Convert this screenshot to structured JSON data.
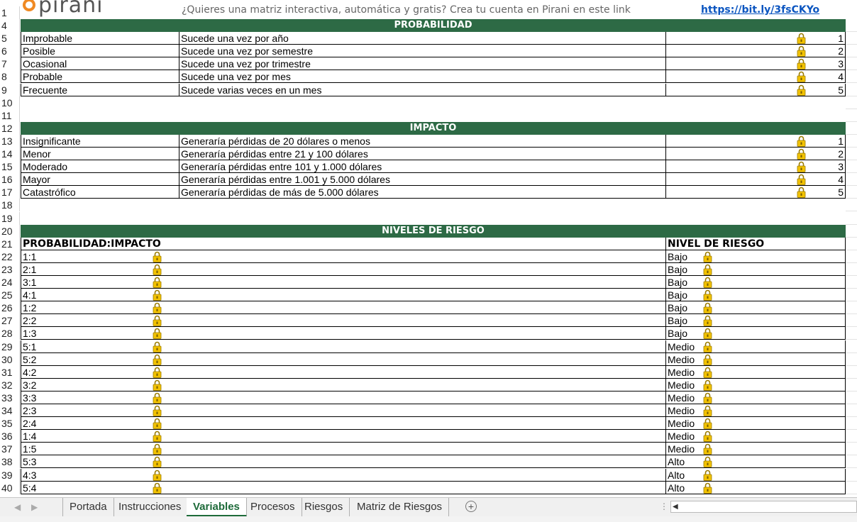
{
  "app": {
    "logo_text": "pirani"
  },
  "promo": {
    "text": "¿Quieres una matriz interactiva, automática y gratis? Crea tu cuenta en Pirani en este link",
    "link": "https://bit.ly/3fsCKYo"
  },
  "row_numbers": [
    "1",
    "4",
    "5",
    "6",
    "7",
    "8",
    "9",
    "10",
    "11",
    "12",
    "13",
    "14",
    "15",
    "16",
    "17",
    "18",
    "19",
    "20",
    "21",
    "22",
    "23",
    "24",
    "25",
    "26",
    "27",
    "28",
    "29",
    "30",
    "31",
    "32",
    "33",
    "34",
    "35",
    "36",
    "37",
    "38",
    "39",
    "40"
  ],
  "probabilidad": {
    "title": "PROBABILIDAD",
    "rows": [
      {
        "name": "Improbable",
        "desc": "Sucede una vez por año",
        "value": "1"
      },
      {
        "name": "Posible",
        "desc": "Sucede una vez por semestre",
        "value": "2"
      },
      {
        "name": "Ocasional",
        "desc": "Sucede una vez por trimestre",
        "value": "3"
      },
      {
        "name": "Probable",
        "desc": "Sucede una vez por mes",
        "value": "4"
      },
      {
        "name": "Frecuente",
        "desc": "Sucede varias veces en un mes",
        "value": "5"
      }
    ]
  },
  "impacto": {
    "title": "IMPACTO",
    "rows": [
      {
        "name": "Insignificante",
        "desc": "Generaría pérdidas de 20 dólares o menos",
        "value": "1"
      },
      {
        "name": "Menor",
        "desc": "Generaría pérdidas entre 21 y 100 dólares",
        "value": "2"
      },
      {
        "name": "Moderado",
        "desc": "Generaría pérdidas entre 101 y 1.000 dólares",
        "value": "3"
      },
      {
        "name": "Mayor",
        "desc": "Generaría pérdidas entre 1.001 y 5.000 dólares",
        "value": "4"
      },
      {
        "name": "Catastrófico",
        "desc": "Generaría pérdidas de más de 5.000 dólares",
        "value": "5"
      }
    ]
  },
  "niveles": {
    "title": "NIVELES DE RIESGO",
    "col1": "PROBABILIDAD:IMPACTO",
    "col2": "NIVEL DE RIESGO",
    "rows": [
      {
        "pi": "1:1",
        "level": "Bajo"
      },
      {
        "pi": "2:1",
        "level": "Bajo"
      },
      {
        "pi": "3:1",
        "level": "Bajo"
      },
      {
        "pi": "4:1",
        "level": "Bajo"
      },
      {
        "pi": "1:2",
        "level": "Bajo"
      },
      {
        "pi": "2:2",
        "level": "Bajo"
      },
      {
        "pi": "1:3",
        "level": "Bajo"
      },
      {
        "pi": "5:1",
        "level": "Medio"
      },
      {
        "pi": "5:2",
        "level": "Medio"
      },
      {
        "pi": "4:2",
        "level": "Medio"
      },
      {
        "pi": "3:2",
        "level": "Medio"
      },
      {
        "pi": "3:3",
        "level": "Medio"
      },
      {
        "pi": "2:3",
        "level": "Medio"
      },
      {
        "pi": "2:4",
        "level": "Medio"
      },
      {
        "pi": "1:4",
        "level": "Medio"
      },
      {
        "pi": "1:5",
        "level": "Medio"
      },
      {
        "pi": "5:3",
        "level": "Alto"
      },
      {
        "pi": "4:3",
        "level": "Alto"
      },
      {
        "pi": "5:4",
        "level": "Alto"
      }
    ]
  },
  "tabs": [
    "Portada",
    "Instrucciones",
    "Variables",
    "Procesos",
    "Riesgos",
    "Matriz de Riesgos"
  ],
  "active_tab": "Variables",
  "colors": {
    "header_green": "#2d6a45",
    "lock_gold": "#f2c200",
    "link_blue": "#0b55c0",
    "logo_orange": "#f08a24"
  },
  "icons": {
    "lock": "lock-icon",
    "add_sheet": "plus-circle-icon"
  }
}
